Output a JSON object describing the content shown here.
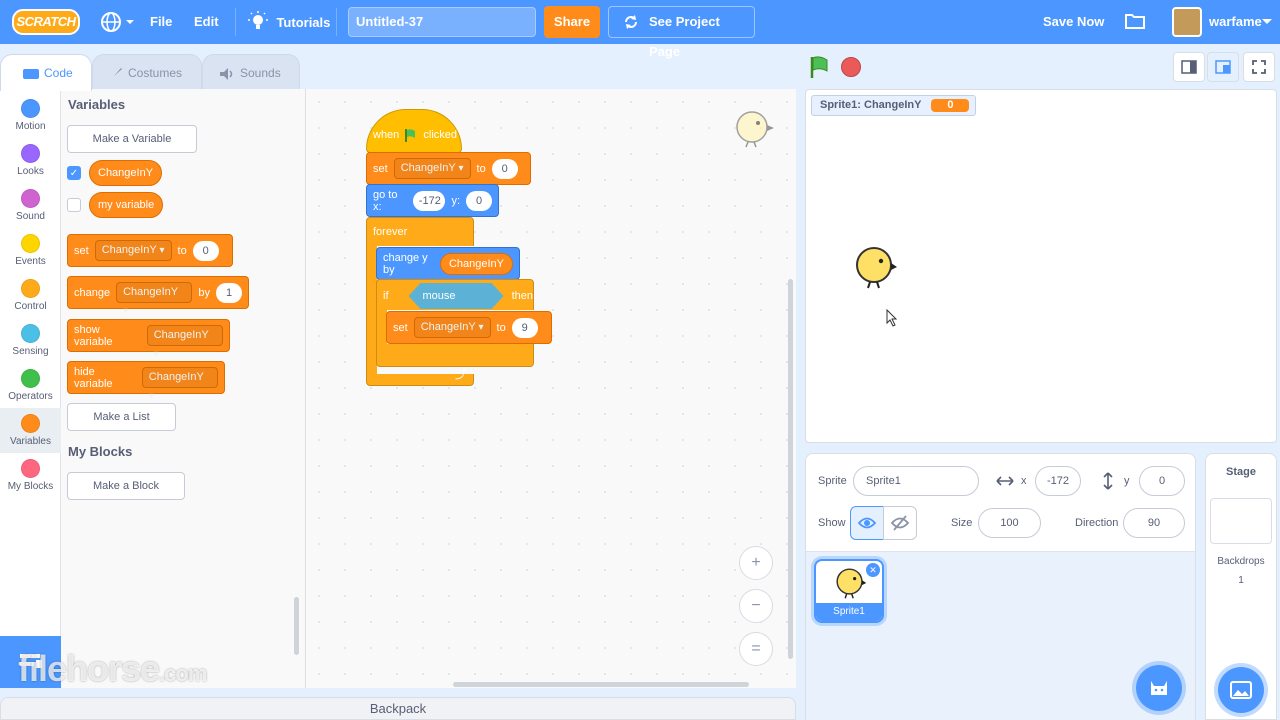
{
  "menubar": {
    "logo": "SCRATCH",
    "file": "File",
    "edit": "Edit",
    "tutorials": "Tutorials",
    "project_title": "Untitled-37",
    "share": "Share",
    "see_project": "See Project Page",
    "save_now": "Save Now",
    "username": "warfame"
  },
  "tabs": {
    "code": "Code",
    "costumes": "Costumes",
    "sounds": "Sounds"
  },
  "categories": [
    {
      "label": "Motion",
      "color": "#4c97ff"
    },
    {
      "label": "Looks",
      "color": "#9966ff"
    },
    {
      "label": "Sound",
      "color": "#cf63cf"
    },
    {
      "label": "Events",
      "color": "#ffd500"
    },
    {
      "label": "Control",
      "color": "#ffab19"
    },
    {
      "label": "Sensing",
      "color": "#4cbfe6"
    },
    {
      "label": "Operators",
      "color": "#40bf4a"
    },
    {
      "label": "Variables",
      "color": "#ff8c1a"
    },
    {
      "label": "My Blocks",
      "color": "#ff6680"
    }
  ],
  "palette": {
    "variables_heading": "Variables",
    "make_variable": "Make a Variable",
    "var1": "ChangeInY",
    "var2": "my variable",
    "set_word": "set",
    "to_word": "to",
    "set_value": "0",
    "change_word": "change",
    "by_word": "by",
    "change_value": "1",
    "show_variable": "show variable",
    "hide_variable": "hide variable",
    "make_list": "Make a List",
    "myblocks_heading": "My Blocks",
    "make_block": "Make a Block"
  },
  "script": {
    "when": "when",
    "clicked": "clicked",
    "set": "set",
    "var": "ChangeInY",
    "to": "to",
    "set_value": "0",
    "goto": "go to x:",
    "x": "-172",
    "y_label": "y:",
    "y": "0",
    "forever": "forever",
    "change_y": "change y by",
    "if": "if",
    "mouse_down": "mouse down?",
    "then": "then",
    "set2_value": "9",
    "loop_arrow": "⤴"
  },
  "zoom": {
    "in": "+",
    "out": "−",
    "reset": "="
  },
  "backpack": "Backpack",
  "stage": {
    "monitor_label": "Sprite1: ChangeInY",
    "monitor_value": "0"
  },
  "sprite_info": {
    "sprite_label": "Sprite",
    "sprite_name": "Sprite1",
    "x_label": "x",
    "x_value": "-172",
    "y_label": "y",
    "y_value": "0",
    "show_label": "Show",
    "size_label": "Size",
    "size_value": "100",
    "direction_label": "Direction",
    "direction_value": "90",
    "tile_name": "Sprite1"
  },
  "stage_pane": {
    "title": "Stage",
    "backdrops_label": "Backdrops",
    "backdrops_count": "1"
  },
  "watermark": {
    "main": "filehorse",
    "suffix": ".com"
  },
  "colors": {
    "accent": "#4c97ff",
    "variables": "#ff8c1a",
    "control": "#ffab19",
    "events": "#ffbf00",
    "motion": "#4c97ff",
    "sensing": "#5cb1d6"
  }
}
